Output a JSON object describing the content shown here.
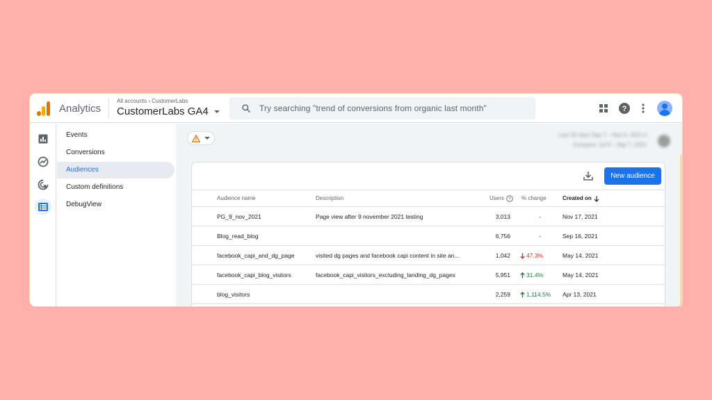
{
  "app": {
    "name": "Analytics",
    "breadcrumb": "All accounts › CustomerLabs",
    "property": "CustomerLabs GA4",
    "search_placeholder": "Try searching \"trend of conversions from organic last month\""
  },
  "nav": {
    "items": [
      {
        "label": "Events",
        "active": false
      },
      {
        "label": "Conversions",
        "active": false
      },
      {
        "label": "Audiences",
        "active": true
      },
      {
        "label": "Custom definitions",
        "active": false
      },
      {
        "label": "DebugView",
        "active": false
      }
    ]
  },
  "toolbar": {
    "new_audience_label": "New audience",
    "blurred_line_1": "Last 30 days  Sep 7 – Nov 6, 2021  ▾",
    "blurred_line_2": "Compare: Jul 9 – Sep 7, 2021"
  },
  "table": {
    "headers": {
      "name": "Audience name",
      "description": "Description",
      "users": "Users",
      "change": "% change",
      "created": "Created on"
    },
    "rows": [
      {
        "name": "PG_9_nov_2021",
        "description": "Page view after 9 november 2021 testing",
        "users": "3,013",
        "change": "-",
        "trend": "none",
        "created": "Nov 17, 2021"
      },
      {
        "name": "Blog_read_blog",
        "description": "",
        "users": "6,756",
        "change": "-",
        "trend": "none",
        "created": "Sep 16, 2021"
      },
      {
        "name": "facebook_capi_and_dg_page",
        "description": "visited dg pages and facebook capi content in site an...",
        "users": "1,042",
        "change": "47.3%",
        "trend": "down",
        "created": "May 14, 2021"
      },
      {
        "name": "facebook_capi_blog_visitors",
        "description": "facebook_capi_visitors_excluding_landing_dg_pages",
        "users": "5,951",
        "change": "31.4%",
        "trend": "up",
        "created": "May 14, 2021"
      },
      {
        "name": "blog_visitors",
        "description": "",
        "users": "2,259",
        "change": "1,114.5%",
        "trend": "up",
        "created": "Apr 13, 2021"
      }
    ]
  },
  "colors": {
    "background": "#ffb0ad",
    "accent": "#1a73e8",
    "up": "#188038",
    "down": "#d93025"
  },
  "icons": {
    "logo": "analytics-logo-icon",
    "search": "search-icon",
    "apps": "apps-grid-icon",
    "help": "help-icon",
    "more": "more-vert-icon",
    "rail": [
      "reports-icon",
      "explore-icon",
      "advertising-icon",
      "configure-icon"
    ],
    "warning": "warning-icon",
    "download": "download-icon"
  }
}
